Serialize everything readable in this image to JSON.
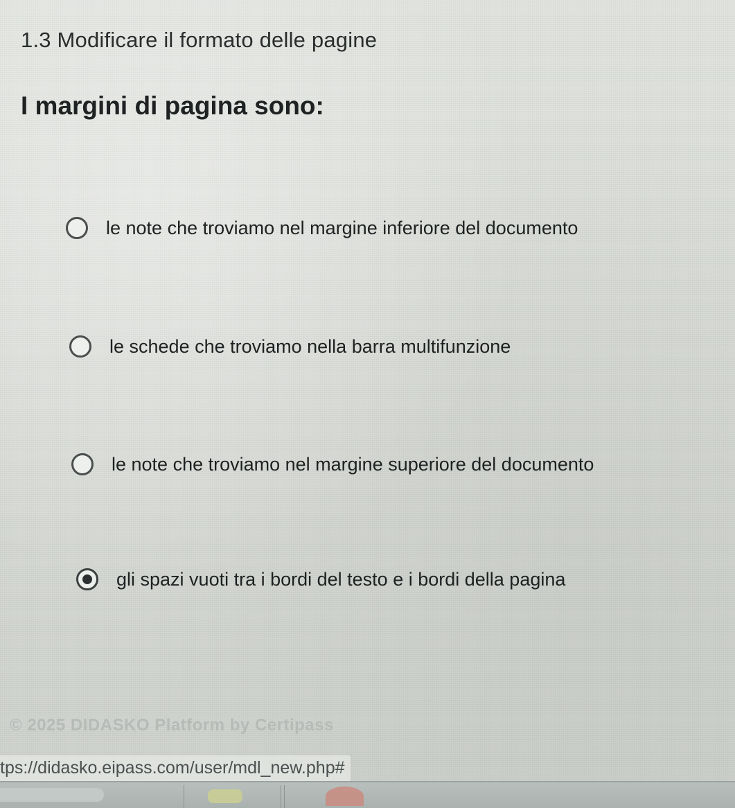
{
  "section": {
    "title": "1.3 Modificare il formato delle pagine"
  },
  "question": {
    "text": "I margini di pagina sono:"
  },
  "options": [
    {
      "label": "le note che troviamo nel margine inferiore del documento",
      "selected": false
    },
    {
      "label": "le schede che troviamo nella barra multifunzione",
      "selected": false
    },
    {
      "label": "le note che troviamo nel margine superiore del documento",
      "selected": false
    },
    {
      "label": "gli spazi vuoti tra i bordi del testo e i bordi della pagina",
      "selected": true
    }
  ],
  "footer": {
    "copyright": "© 2025 DIDASKO Platform by Certipass"
  },
  "status_bar": {
    "url": "tps://didasko.eipass.com/user/mdl_new.php#"
  }
}
